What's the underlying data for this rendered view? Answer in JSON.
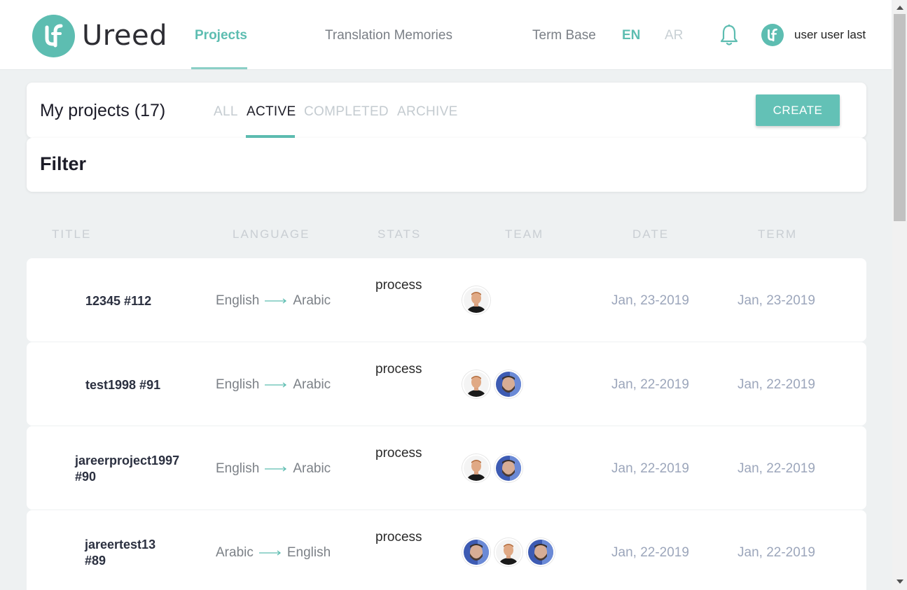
{
  "header": {
    "logo_text": "Ureed",
    "nav": {
      "projects": "Projects",
      "translation_memories": "Translation Memories",
      "term_base": "Term Base"
    },
    "lang_en": "EN",
    "lang_ar": "AR",
    "user_name": "user user last"
  },
  "projects_bar": {
    "title": "My projects (17)",
    "tabs": {
      "all": "ALL",
      "active": "ACTIVE",
      "completed": "COMPLETED",
      "archive": "ARCHIVE"
    },
    "create_label": "CREATE"
  },
  "filter": {
    "title": "Filter"
  },
  "columns": {
    "title": "TITLE",
    "language": "LANGUAGE",
    "stats": "STATS",
    "team": "TEAM",
    "date": "DATE",
    "term": "TERM"
  },
  "projects": [
    {
      "title_line1": "12345 #112",
      "title_line2": "",
      "source": "English",
      "target": "Arabic",
      "status": "process",
      "team": [
        "man-avatar"
      ],
      "date": "Jan, 23-2019",
      "term": "Jan, 23-2019"
    },
    {
      "title_line1": "test1998 #91",
      "title_line2": "",
      "source": "English",
      "target": "Arabic",
      "status": "process",
      "team": [
        "man-avatar",
        "bearded-man-avatar"
      ],
      "date": "Jan, 22-2019",
      "term": "Jan, 22-2019"
    },
    {
      "title_line1": "jareerproject1997",
      "title_line2": "#90",
      "source": "English",
      "target": "Arabic",
      "status": "process",
      "team": [
        "man-avatar",
        "bearded-man-avatar"
      ],
      "date": "Jan, 22-2019",
      "term": "Jan, 22-2019"
    },
    {
      "title_line1": "jareertest13",
      "title_line2": "#89",
      "source": "Arabic",
      "target": "English",
      "status": "process",
      "team": [
        "bearded-man-avatar",
        "man-avatar",
        "bearded-man-avatar"
      ],
      "date": "Jan, 22-2019",
      "term": "Jan, 22-2019"
    }
  ],
  "colors": {
    "accent": "#5dbdb1",
    "date": "#9ca6bb",
    "background": "#eef1f2"
  }
}
